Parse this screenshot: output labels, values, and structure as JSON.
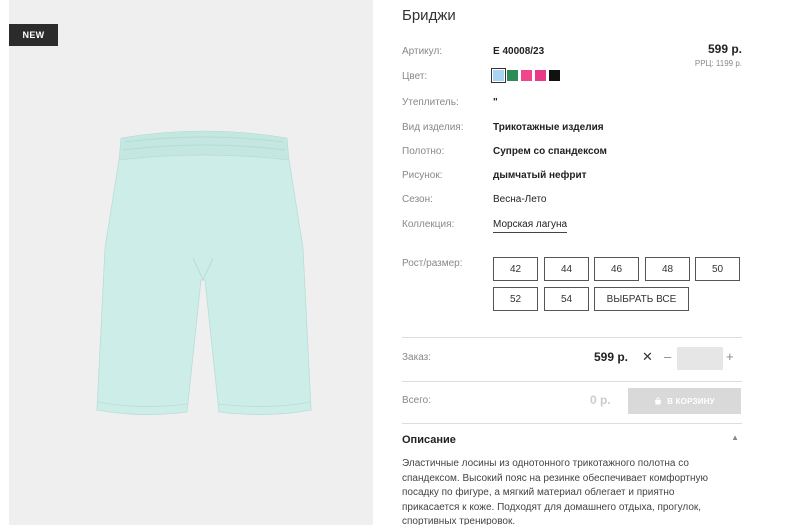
{
  "badge": "NEW",
  "product": {
    "title": "Бриджи",
    "price": "599 р.",
    "rrp": "РРЦ: 1199 р."
  },
  "attributes": {
    "article_label": "Артикул:",
    "article_value": "Е 40008/23",
    "color_label": "Цвет:",
    "insulation_label": "Утеплитель:",
    "insulation_value": "\"",
    "type_label": "Вид изделия:",
    "type_value": "Трикотажные изделия",
    "fabric_label": "Полотно:",
    "fabric_value": "Супрем со спандексом",
    "pattern_label": "Рисунок:",
    "pattern_value": "дымчатый нефрит",
    "season_label": "Сезон:",
    "season_value": "Весна-Лето",
    "collection_label": "Коллекция:",
    "collection_value": "Морская лагуна"
  },
  "colors": [
    "#a9d3f2",
    "#2e8b57",
    "#f0468c",
    "#e83a86",
    "#111111"
  ],
  "sizes": {
    "label": "Рост/размер:",
    "options": [
      "42",
      "44",
      "46",
      "48",
      "50",
      "52",
      "54"
    ],
    "select_all": "ВЫБРАТЬ ВСЕ"
  },
  "order": {
    "label": "Заказ:",
    "price": "599 р.",
    "times": "✕",
    "minus": "–",
    "plus": "+",
    "quantity": ""
  },
  "total": {
    "label": "Всего:",
    "price": "0 р.",
    "cart_button": "В КОРЗИНУ"
  },
  "description": {
    "title": "Описание",
    "toggle": "▲",
    "text": "Эластичные лосины из однотонного трикотажного полотна со спандексом. Высокий пояс на резинке обеспечивает комфортную посадку по фигуре, а мягкий материал облегает и приятно прикасается к коже. Подходят для домашнего отдыха, прогулок, спортивных тренировок."
  }
}
